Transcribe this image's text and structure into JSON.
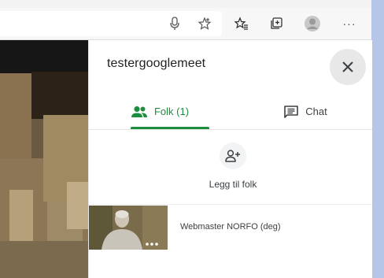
{
  "browser": {
    "icons": [
      "microphone-icon",
      "favorite-star-icon",
      "favorites-list-icon",
      "collections-icon",
      "profile-avatar-icon",
      "more-options-icon"
    ],
    "more_label": "···"
  },
  "panel": {
    "title": "testergooglemeet",
    "close_icon": "close-icon",
    "tabs": [
      {
        "label": "Folk (1)",
        "icon": "people-icon",
        "active": true
      },
      {
        "label": "Chat",
        "icon": "chat-icon",
        "active": false
      }
    ],
    "add_people": {
      "label": "Legg til folk",
      "icon": "add-person-icon"
    },
    "participants": [
      {
        "name": "Webmaster NORFO (deg)"
      }
    ]
  },
  "colors": {
    "accent_green": "#1e8e3e",
    "text_dark": "#202124",
    "text_secondary": "#3c4043",
    "side_strip": "#b5c6e8"
  }
}
